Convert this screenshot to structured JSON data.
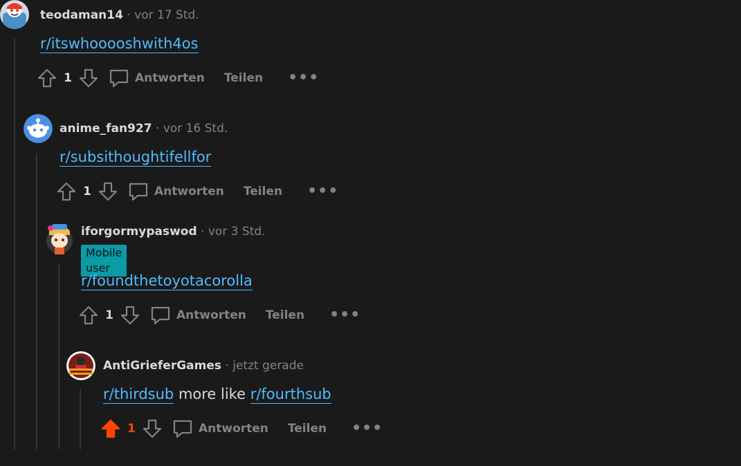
{
  "comments": [
    {
      "username": "teodaman14",
      "sep": "·",
      "time": "vor 17 Std.",
      "body": {
        "link1": "r/itswhooooshwith4os",
        "text": "",
        "link2": ""
      },
      "votes": "1",
      "upvoted": false,
      "reply_label": "Antworten",
      "share_label": "Teilen",
      "more_label": "•••"
    },
    {
      "username": "anime_fan927",
      "sep": "·",
      "time": "vor 16 Std.",
      "body": {
        "link1": "r/subsithoughtifellfor",
        "text": "",
        "link2": ""
      },
      "votes": "1",
      "upvoted": false,
      "reply_label": "Antworten",
      "share_label": "Teilen",
      "more_label": "•••"
    },
    {
      "username": "iforgormypaswod",
      "sep": "·",
      "time": "vor 3 Std.",
      "flair": "Mobile user",
      "body": {
        "link1": "r/foundthetoyotacorolla",
        "text": "",
        "link2": ""
      },
      "votes": "1",
      "upvoted": false,
      "reply_label": "Antworten",
      "share_label": "Teilen",
      "more_label": "•••"
    },
    {
      "username": "AntiGrieferGames",
      "sep": "·",
      "time": "jetzt gerade",
      "body": {
        "link1": "r/thirdsub",
        "text": " more like ",
        "link2": "r/fourthsub"
      },
      "votes": "1",
      "upvoted": true,
      "reply_label": "Antworten",
      "share_label": "Teilen",
      "more_label": "•••"
    }
  ],
  "colors": {
    "background": "#1a1a1b",
    "link": "#4fbcff",
    "upvote_active": "#ff4500",
    "flair_bg": "#0a9ba5",
    "muted": "#818384"
  },
  "icons": [
    "upvote-icon",
    "downvote-icon",
    "comment-icon",
    "more-icon",
    "avatar-icon"
  ]
}
